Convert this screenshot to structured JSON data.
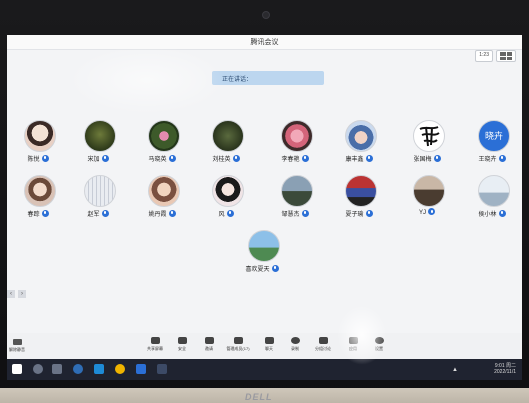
{
  "window": {
    "title": "腾讯会议"
  },
  "header_buttons": [
    {
      "label": "1:23"
    }
  ],
  "speaking": {
    "label": "正在讲话："
  },
  "participants": [
    {
      "name": "陈悦"
    },
    {
      "name": "宋加"
    },
    {
      "name": "马晓英"
    },
    {
      "name": "刘桂英"
    },
    {
      "name": "李春艳"
    },
    {
      "name": "康丰鑫"
    },
    {
      "name": "张国梅"
    },
    {
      "name": "王晓卉"
    },
    {
      "name": "春踪"
    },
    {
      "name": "赵军"
    },
    {
      "name": "姚丹霞"
    },
    {
      "name": "风"
    },
    {
      "name": "邹慧杰"
    },
    {
      "name": "夏子瑜"
    },
    {
      "name": "YJ"
    },
    {
      "name": "侯小林"
    },
    {
      "name": "喜欢夏天"
    }
  ],
  "avatar_texts": {
    "p7": "晓卉"
  },
  "side_controls": [
    "‹",
    "›"
  ],
  "toolbar": {
    "left": {
      "label": "解除静音"
    },
    "items": [
      {
        "label": "共享屏幕",
        "icon": "screen-share-icon"
      },
      {
        "label": "安全",
        "icon": "shield-icon"
      },
      {
        "label": "邀请",
        "icon": "invite-icon"
      },
      {
        "label": "管理成员(17)",
        "icon": "members-icon"
      },
      {
        "label": "聊天",
        "icon": "chat-icon"
      },
      {
        "label": "录制",
        "icon": "record-icon"
      },
      {
        "label": "分组讨论",
        "icon": "breakout-icon"
      },
      {
        "label": "应用",
        "icon": "apps-icon"
      },
      {
        "label": "设置",
        "icon": "gear-icon"
      }
    ]
  },
  "taskbar": {
    "time": "9:01 周二",
    "date": "2022/11/1"
  },
  "bezel": {
    "brand": "DELL"
  },
  "colors": {
    "accent": "#2b6fd6",
    "speaking_bg": "#bcd6ef",
    "taskbar": "#1f2330"
  }
}
